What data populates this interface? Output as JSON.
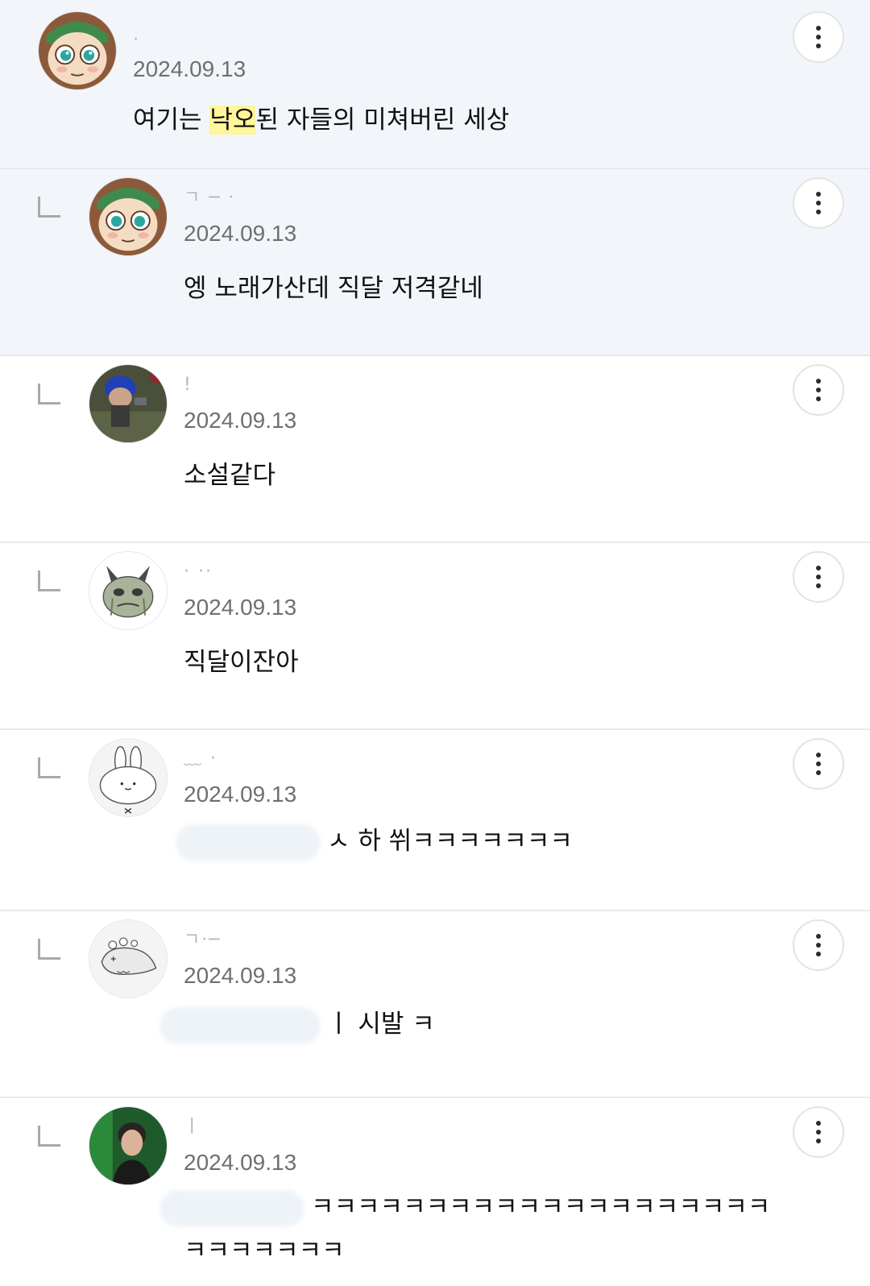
{
  "comments": [
    {
      "type": "top",
      "author": "·",
      "date": "2024.09.13",
      "text_before": "여기는 ",
      "text_highlight": "낙오",
      "text_after": "된 자들의 미쳐버린 세상",
      "avatar_icon": "green-hat-character-avatar-icon"
    },
    {
      "type": "reply",
      "author": "ㄱ  ─ ·",
      "date": "2024.09.13",
      "text": "엥 노래가산데 직달 저격같네",
      "avatar_icon": "green-hat-character-avatar-icon"
    },
    {
      "type": "reply",
      "author": "!",
      "date": "2024.09.13",
      "text": "소설같다",
      "avatar_icon": "blue-hair-game-character-avatar-icon"
    },
    {
      "type": "reply",
      "author": "· ··",
      "date": "2024.09.13",
      "text": "직달이잔아",
      "avatar_icon": "crying-frog-avatar-icon"
    },
    {
      "type": "reply",
      "author": "﹏ ·",
      "date": "2024.09.13",
      "text": "하 쒸ㅋㅋㅋㅋㅋㅋㅋ",
      "text_prefix": "ㅅ",
      "avatar_icon": "bunny-doodle-avatar-icon"
    },
    {
      "type": "reply",
      "author": "ㄱ·─",
      "date": "2024.09.13",
      "text": "시발 ㅋ",
      "text_prefix": "ㅣ",
      "avatar_icon": "seal-doodle-avatar-icon"
    },
    {
      "type": "reply",
      "author": "ㅣ",
      "date": "2024.09.13",
      "text": "ㅋㅋㅋㅋㅋㅋㅋㅋㅋㅋㅋㅋㅋㅋㅋㅋㅋㅋㅋㅋ",
      "text_line2": "ㅋㅋㅋㅋㅋㅋㅋ",
      "avatar_icon": "person-photo-avatar-icon"
    }
  ],
  "colors": {
    "highlight_row": "#f2f6fb",
    "keyword_highlight": "#fff59a",
    "divider": "#e8e9ec",
    "date_text": "#6f6f6f"
  }
}
